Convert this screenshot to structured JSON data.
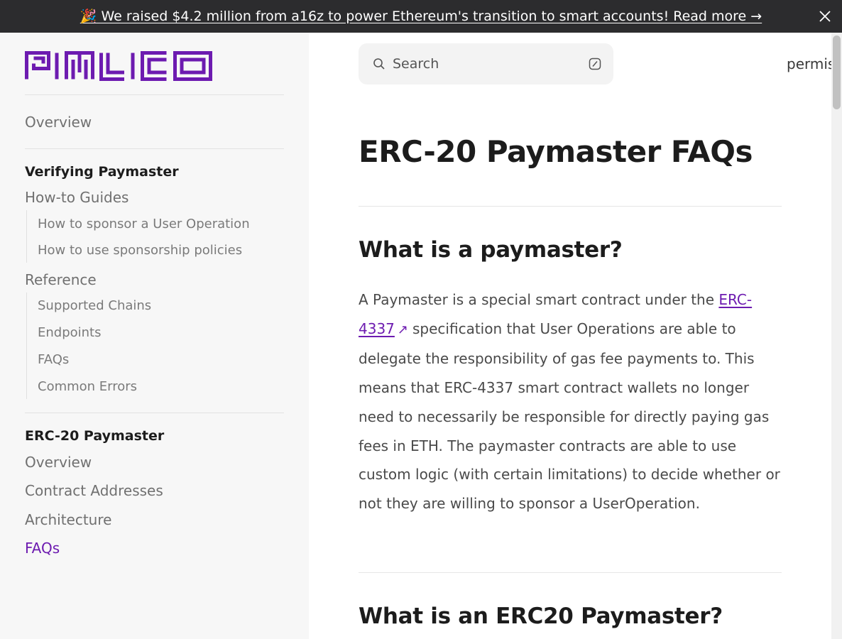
{
  "banner": {
    "text": "🎉 We raised $4.2 million from a16z to power Ethereum's transition to smart accounts! Read more →"
  },
  "brand": {
    "logo_text": "PIMLICO",
    "color": "#6d1bb0"
  },
  "sidebar": {
    "overview": "Overview",
    "verifying": {
      "title": "Verifying Paymaster",
      "howto": {
        "label": "How-to Guides",
        "items": [
          "How to sponsor a User Operation",
          "How to use sponsorship policies"
        ]
      },
      "reference": {
        "label": "Reference",
        "items": [
          "Supported Chains",
          "Endpoints",
          "FAQs",
          "Common Errors"
        ]
      }
    },
    "erc20": {
      "title": "ERC-20 Paymaster",
      "items": [
        "Overview",
        "Contract Addresses",
        "Architecture",
        "FAQs"
      ],
      "active_index": 3
    }
  },
  "header": {
    "search_placeholder": "Search",
    "nav_partial": "permis"
  },
  "content": {
    "title": "ERC-20 Paymaster FAQs",
    "sections": [
      {
        "heading": "What is a paymaster?",
        "body_before_link": "A Paymaster is a special smart contract under the ",
        "link": "ERC-4337",
        "body_after_link": "specification that User Operations are able to delegate the responsibility of gas fee payments to. This means that ERC-4337 smart contract wallets no longer need to necessarily be responsible for directly paying gas fees in ETH. The paymaster contracts are able to use custom logic (with certain limitations) to decide whether or not they are willing to sponsor a UserOperation."
      },
      {
        "heading": "What is an ERC20 Paymaster?"
      }
    ]
  },
  "icons": {
    "banner_close": "close-icon",
    "search": "search-icon",
    "search_shortcut": "slash-key-icon",
    "external_link": "external-link-icon"
  }
}
